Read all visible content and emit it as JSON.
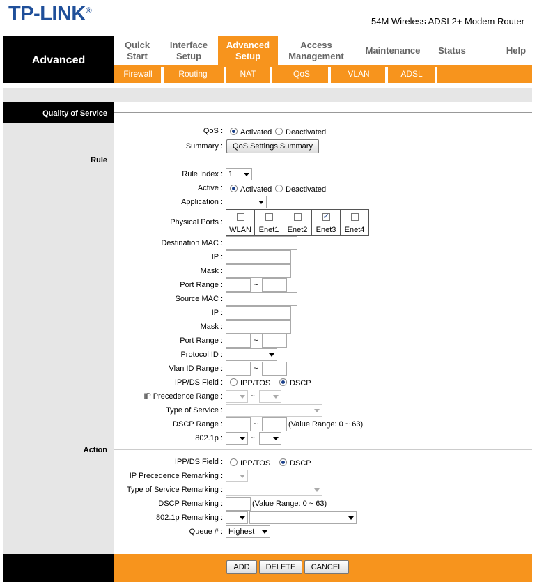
{
  "header": {
    "logo": "TP-LINK",
    "logo_mark": "®",
    "model": "54M Wireless ADSL2+ Modem Router"
  },
  "nav": {
    "section_title": "Advanced",
    "items": [
      {
        "label": "Quick Start"
      },
      {
        "label": "Interface Setup"
      },
      {
        "label": "Advanced Setup"
      },
      {
        "label": "Access Management"
      },
      {
        "label": "Maintenance"
      },
      {
        "label": "Status"
      },
      {
        "label": "Help"
      }
    ],
    "subitems": [
      {
        "label": "Firewall"
      },
      {
        "label": "Routing"
      },
      {
        "label": "NAT"
      },
      {
        "label": "QoS"
      },
      {
        "label": "VLAN"
      },
      {
        "label": "ADSL"
      }
    ]
  },
  "qos_section": {
    "title": "Quality of Service",
    "qos_label": "QoS :",
    "activated": "Activated",
    "deactivated": "Deactivated",
    "summary_label": "Summary :",
    "summary_button": "QoS Settings Summary"
  },
  "rule": {
    "title": "Rule",
    "rule_index_label": "Rule Index :",
    "rule_index_value": "1",
    "active_label": "Active :",
    "activated": "Activated",
    "deactivated": "Deactivated",
    "application_label": "Application :",
    "physical_ports_label": "Physical Ports :",
    "ports": [
      {
        "name": "WLAN",
        "checked": false
      },
      {
        "name": "Enet1",
        "checked": false
      },
      {
        "name": "Enet2",
        "checked": false
      },
      {
        "name": "Enet3",
        "checked": true
      },
      {
        "name": "Enet4",
        "checked": false
      }
    ],
    "dest_mac_label": "Destination MAC :",
    "dest_ip_label": "IP :",
    "dest_mask_label": "Mask :",
    "dest_port_range_label": "Port Range :",
    "src_mac_label": "Source MAC :",
    "src_ip_label": "IP :",
    "src_mask_label": "Mask :",
    "src_port_range_label": "Port Range :",
    "protocol_id_label": "Protocol ID :",
    "vlan_id_range_label": "Vlan ID Range :",
    "ippds_label": "IPP/DS Field :",
    "ipptos": "IPP/TOS",
    "dscp": "DSCP",
    "ip_prec_range_label": "IP Precedence Range :",
    "tos_label": "Type of Service :",
    "dscp_range_label": "DSCP Range :",
    "dscp_range_note": "(Value Range: 0 ~ 63)",
    "dot1p_label": "802.1p :",
    "tilde": "~"
  },
  "action": {
    "title": "Action",
    "ippds_label": "IPP/DS Field :",
    "ipptos": "IPP/TOS",
    "dscp": "DSCP",
    "ip_prec_remark_label": "IP Precedence Remarking :",
    "tos_remark_label": "Type of Service Remarking :",
    "dscp_remark_label": "DSCP Remarking :",
    "dscp_remark_note": "(Value Range: 0 ~ 63)",
    "dot1p_remark_label": "802.1p Remarking :",
    "queue_label": "Queue # :",
    "queue_value": "Highest"
  },
  "footer": {
    "add": "ADD",
    "delete": "DELETE",
    "cancel": "CANCEL"
  },
  "colors": {
    "accent": "#f7941d",
    "logo": "#1f4f9a"
  }
}
